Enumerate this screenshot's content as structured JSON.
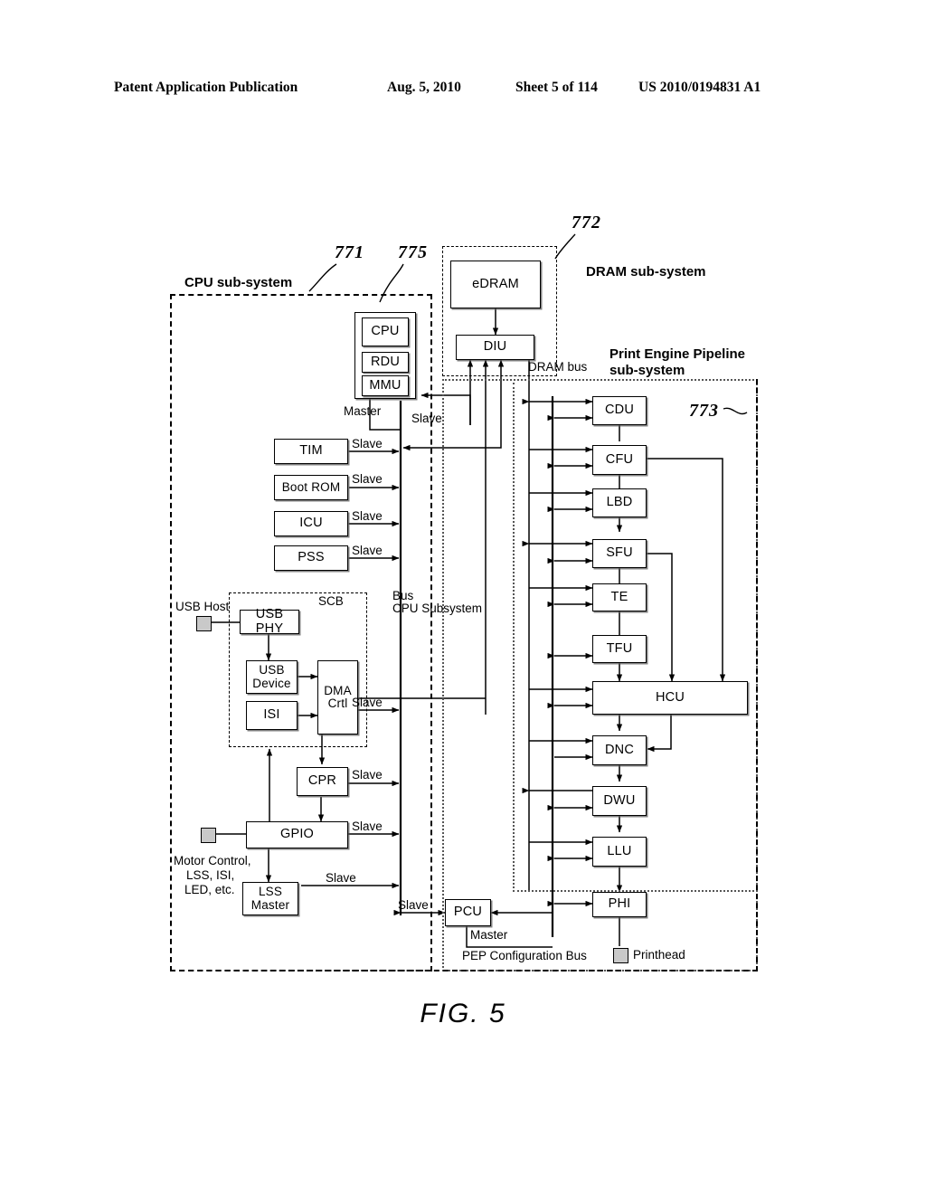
{
  "header": {
    "publication": "Patent Application Publication",
    "date": "Aug. 5, 2010",
    "sheet": "Sheet 5 of 114",
    "number": "US 2010/0194831 A1"
  },
  "figure": {
    "caption": "FIG. 5"
  },
  "subsystems": {
    "cpu": {
      "title": "CPU sub-system",
      "ref": "771"
    },
    "dram": {
      "title": "DRAM sub-system",
      "ref": "772"
    },
    "pep": {
      "title": "Print Engine Pipeline\nsub-system",
      "pep_line1": "Print Engine Pipeline",
      "pep_line2": "sub-system",
      "ref": "773"
    },
    "cpu_core": {
      "ref": "775"
    },
    "scb": {
      "title": "SCB"
    }
  },
  "blocks": {
    "cpu": "CPU",
    "rdu": "RDU",
    "mmu": "MMU",
    "edram": "eDRAM",
    "diu": "DIU",
    "tim": "TIM",
    "bootrom": "Boot ROM",
    "icu": "ICU",
    "pss": "PSS",
    "usbphy": "USB PHY",
    "usbdevice_l1": "USB",
    "usbdevice_l2": "Device",
    "isi": "ISI",
    "dma_l1": "DMA",
    "dma_l2": "Crtl",
    "cpr": "CPR",
    "gpio": "GPIO",
    "lss_l1": "LSS",
    "lss_l2": "Master",
    "pcu": "PCU",
    "cdu": "CDU",
    "cfu": "CFU",
    "lbd": "LBD",
    "sfu": "SFU",
    "te": "TE",
    "tfu": "TFU",
    "hcu": "HCU",
    "dnc": "DNC",
    "dwu": "DWU",
    "llu": "LLU",
    "phi": "PHI"
  },
  "annotations": {
    "master": "Master",
    "slave": "Slave",
    "bus_l1": "Bus",
    "bus_l2": "CPU Subsystem",
    "dram_bus": "DRAM bus",
    "pep_config_bus": "PEP Configuration Bus",
    "usb_host": "USB Host",
    "printhead": "Printhead",
    "motor_l1": "Motor Control,",
    "motor_l2": "LSS, ISI,",
    "motor_l3": "LED, etc."
  },
  "slave_labels": [
    "Slave",
    "Slave",
    "Slave",
    "Slave",
    "Slave",
    "Slave",
    "Slave",
    "Slave",
    "Slave",
    "Slave"
  ],
  "colors": {
    "line": "#000000",
    "pad": "#c9c9c9",
    "dashed": "#000000"
  }
}
